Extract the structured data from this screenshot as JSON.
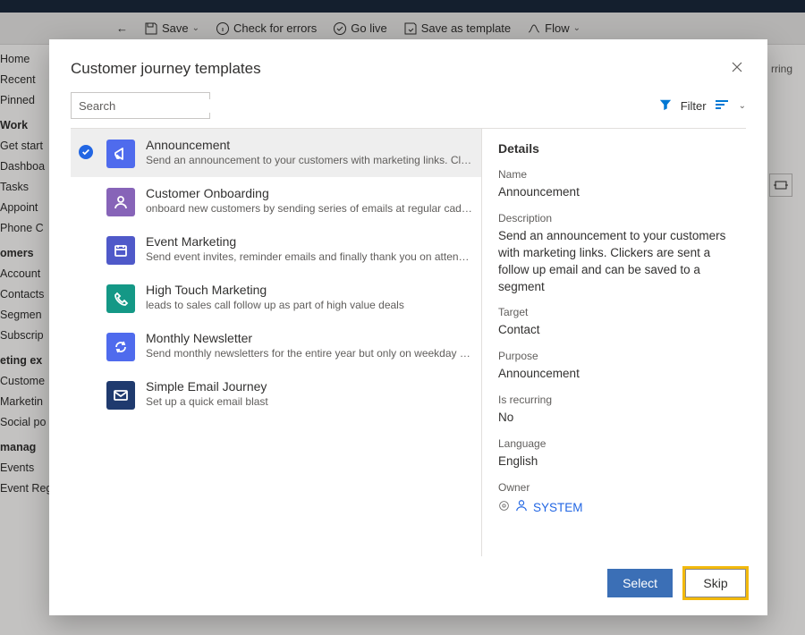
{
  "command_bar": {
    "back": "←",
    "save": "Save",
    "check_errors": "Check for errors",
    "go_live": "Go live",
    "save_template": "Save as template",
    "flow": "Flow"
  },
  "left_nav": {
    "items1": [
      "Home",
      "Recent",
      "Pinned"
    ],
    "hdr_work": "Work",
    "items2": [
      "Get start",
      "Dashboa",
      "Tasks",
      "Appoint",
      "Phone C"
    ],
    "hdr_cust": "omers",
    "items3": [
      "Account",
      "Contacts",
      "Segmen",
      "Subscrip"
    ],
    "hdr_exec": "eting ex",
    "items4": [
      "Custome",
      "Marketin",
      "Social po"
    ],
    "hdr_mgmt": "manag",
    "items5": [
      "Events",
      "Event Registrations"
    ]
  },
  "bg_right": {
    "recurring": "rring"
  },
  "modal": {
    "title": "Customer journey templates",
    "search_placeholder": "Search",
    "filter_label": "Filter"
  },
  "templates": [
    {
      "title": "Announcement",
      "desc": "Send an announcement to your customers with marketing links. Clickers are sent a…",
      "icon": "megaphone",
      "color": "ic-blue",
      "selected": true
    },
    {
      "title": "Customer Onboarding",
      "desc": "onboard new customers by sending series of emails at regular cadence",
      "icon": "person",
      "color": "ic-purple",
      "selected": false
    },
    {
      "title": "Event Marketing",
      "desc": "Send event invites, reminder emails and finally thank you on attending",
      "icon": "calendar",
      "color": "ic-indigo",
      "selected": false
    },
    {
      "title": "High Touch Marketing",
      "desc": "leads to sales call follow up as part of high value deals",
      "icon": "phone",
      "color": "ic-teal",
      "selected": false
    },
    {
      "title": "Monthly Newsletter",
      "desc": "Send monthly newsletters for the entire year but only on weekday afternoons",
      "icon": "refresh",
      "color": "ic-blue",
      "selected": false
    },
    {
      "title": "Simple Email Journey",
      "desc": "Set up a quick email blast",
      "icon": "mail",
      "color": "ic-navy",
      "selected": false
    }
  ],
  "details": {
    "heading": "Details",
    "labels": {
      "name": "Name",
      "description": "Description",
      "target": "Target",
      "purpose": "Purpose",
      "recurring": "Is recurring",
      "language": "Language",
      "owner": "Owner"
    },
    "name": "Announcement",
    "description": "Send an announcement to your customers with marketing links. Clickers are sent a follow up email and can be saved to a segment",
    "target": "Contact",
    "purpose": "Announcement",
    "recurring": "No",
    "language": "English",
    "owner": "SYSTEM"
  },
  "buttons": {
    "select": "Select",
    "skip": "Skip"
  }
}
